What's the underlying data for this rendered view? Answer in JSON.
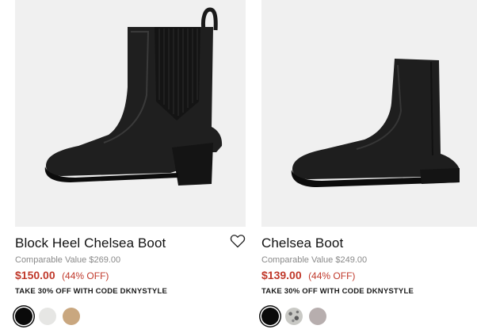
{
  "products": [
    {
      "title": "Block Heel Chelsea Boot",
      "comparable": "Comparable Value $269.00",
      "price": "$150.00",
      "discount": "(44% OFF)",
      "promo": "TAKE 30% OFF WITH CODE DKNYSTYLE",
      "wishlist_icon": "heart-outline-icon",
      "swatches": [
        {
          "color": "#0a0a0a",
          "selected": true
        },
        {
          "color": "#e6e6e4",
          "selected": false
        },
        {
          "color": "#c9a77f",
          "selected": false
        }
      ]
    },
    {
      "title": "Chelsea Boot",
      "comparable": "Comparable Value $249.00",
      "price": "$139.00",
      "discount": "(44% OFF)",
      "promo": "TAKE 30% OFF WITH CODE DKNYSTYLE",
      "swatches": [
        {
          "color": "#0a0a0a",
          "selected": true
        },
        {
          "color": "#c9c9c5",
          "pattern": "snake",
          "selected": false
        },
        {
          "color": "#b7aeae",
          "selected": false
        }
      ]
    }
  ],
  "colors": {
    "sale_red": "#c0392b",
    "image_bg": "#f0f0f0",
    "muted_text": "#8a8a8a"
  }
}
